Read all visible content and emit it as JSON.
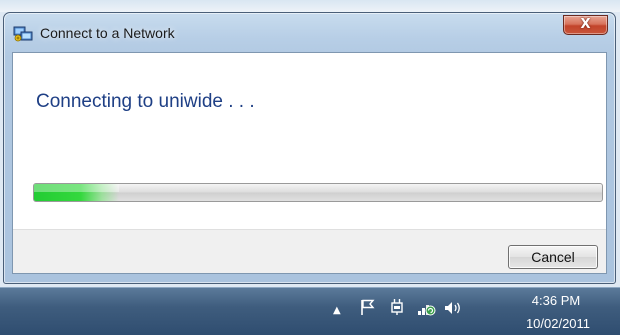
{
  "window": {
    "title": "Connect to a Network",
    "close_label": "X",
    "heading": "Connecting to uniwide . . .",
    "progress_percent": 15,
    "cancel_label": "Cancel"
  },
  "taskbar": {
    "time": "4:36 PM",
    "date": "10/02/2011",
    "icons": [
      "show-hidden-icons",
      "action-center-flag-icon",
      "power-icon",
      "network-icon",
      "volume-icon"
    ]
  }
}
